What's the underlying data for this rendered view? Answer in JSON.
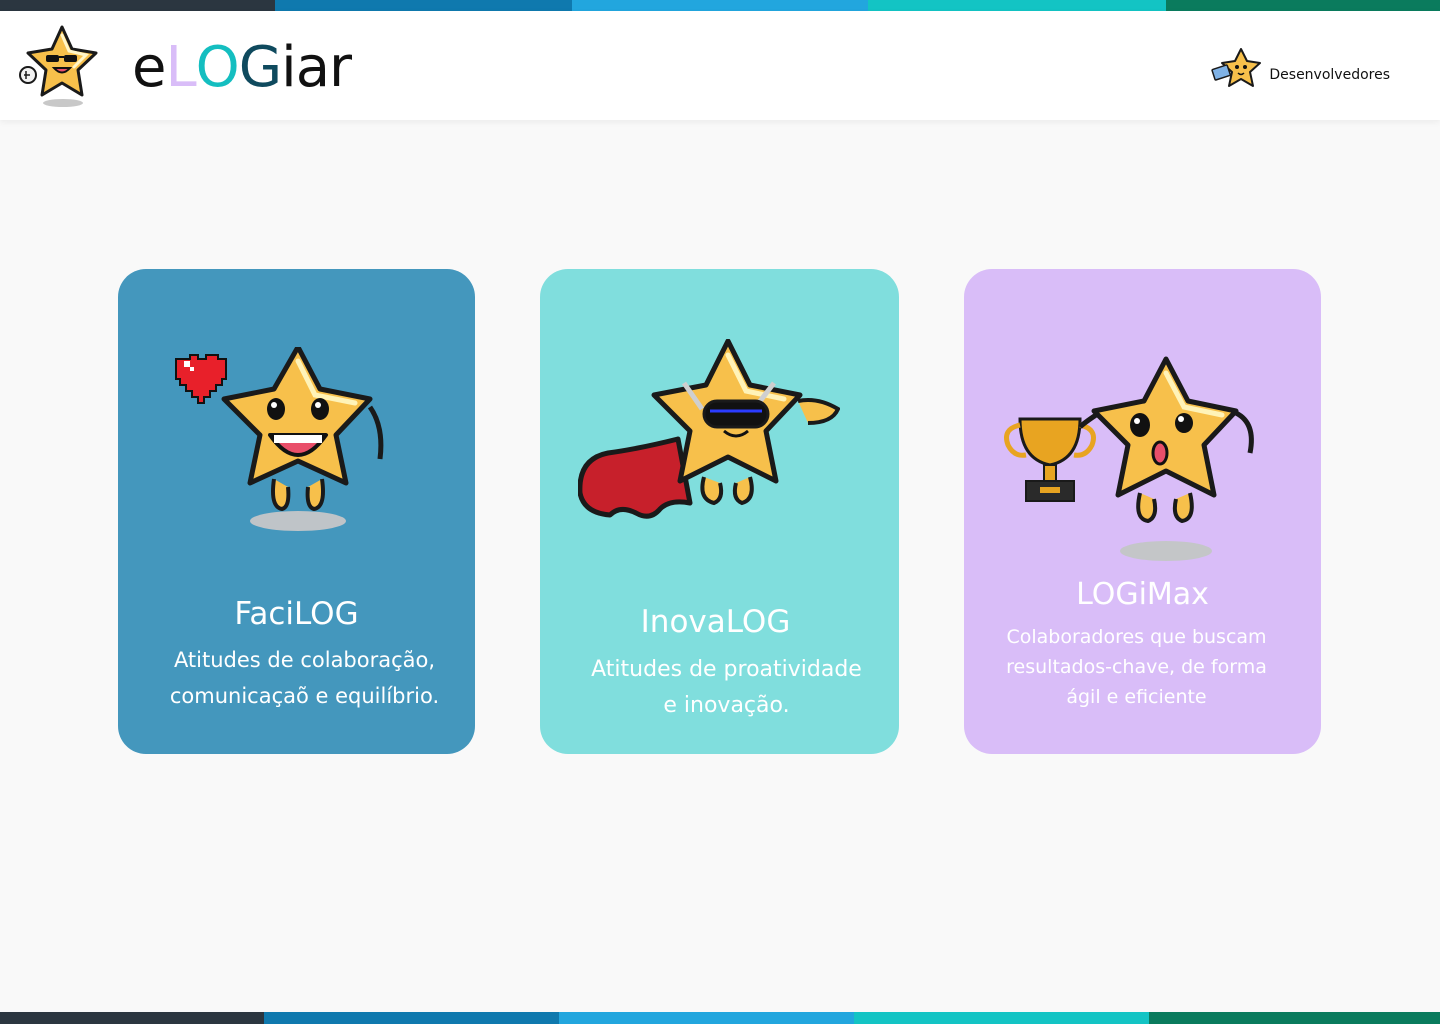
{
  "brand": {
    "letters": [
      {
        "char": "e",
        "color": "#111111"
      },
      {
        "char": "L",
        "color": "#d9bdf8"
      },
      {
        "char": "O",
        "color": "#14bec0"
      },
      {
        "char": "G",
        "color": "#0f4a5e"
      },
      {
        "char": "iar",
        "color": "#111111"
      }
    ]
  },
  "header": {
    "dev_label": "Desenvolvedores"
  },
  "cards": [
    {
      "title": "FaciLOG",
      "line1": "Atitudes de colaboração,",
      "line2": "comunicaçaõ e equilíbrio.",
      "color": "#4497bd",
      "icon": "star-heart-mascot-icon"
    },
    {
      "title": "InovaLOG",
      "line1": "Atitudes de proatividade",
      "line2": "e  inovação.",
      "color": "#80dedd",
      "icon": "star-superhero-mascot-icon"
    },
    {
      "title": "LOGiMax",
      "line1": "Colaboradores que buscam",
      "line2": "resultados-chave, de forma",
      "line3": "ágil e eficiente",
      "color": "#d9bdf8",
      "icon": "star-trophy-mascot-icon"
    }
  ],
  "colors": {
    "stripe": [
      "#2b3640",
      "#0f79ae",
      "#22a6de",
      "#13c4c4",
      "#0a7b5d"
    ],
    "star_fill": "#f7c04b",
    "star_outline": "#1a1a1a"
  }
}
